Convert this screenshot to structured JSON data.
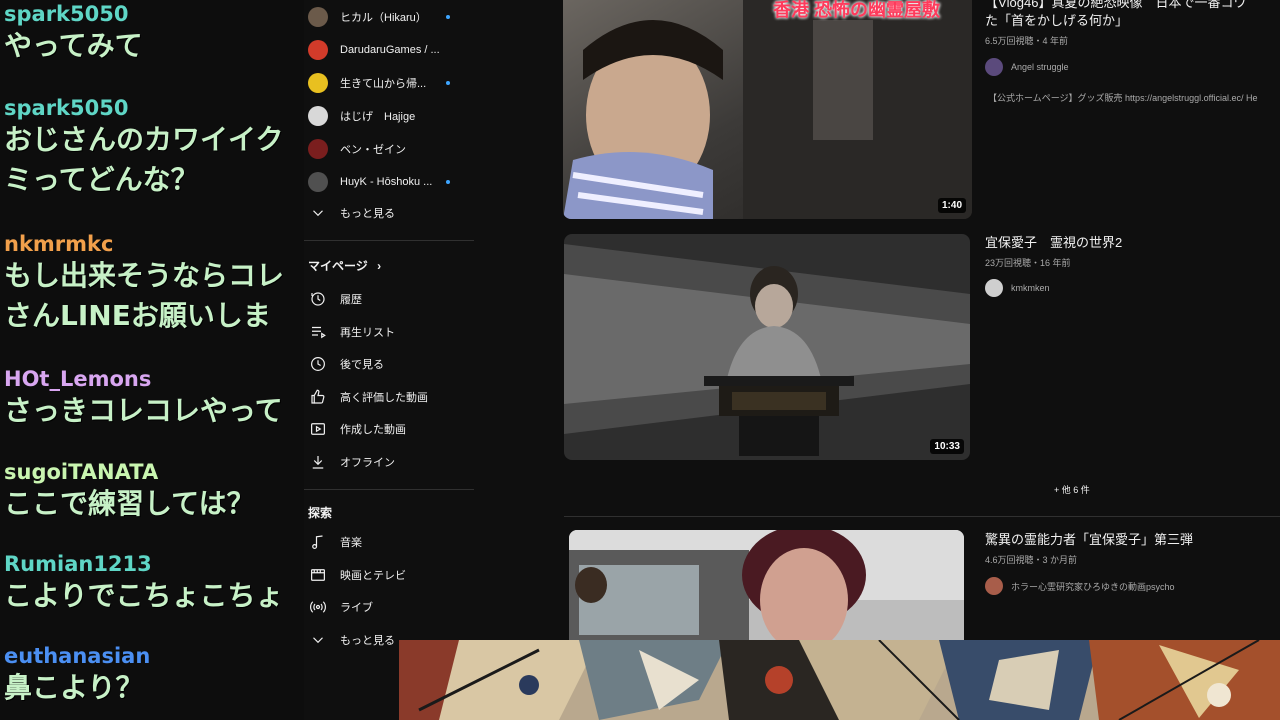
{
  "chat": {
    "messages": [
      {
        "user": "spark5050",
        "text": "やってみて",
        "user_color": "#5fd6c6"
      },
      {
        "user": "spark5050",
        "text": "おじさんのカワイイク\nミってどんな？",
        "user_color": "#5fd6c6"
      },
      {
        "user": "nkmrmkc",
        "text": "もし出来そうならコレ\nさんLINEお願いしま",
        "user_color": "#f2a04b"
      },
      {
        "user": "HOt_Lemons",
        "text": "さっきコレコレやって",
        "user_color": "#d8a6f0"
      },
      {
        "user": "sugoiTANATA",
        "text": "ここで練習しては？",
        "user_color": "#c9f5b0"
      },
      {
        "user": "Rumian1213",
        "text": "こよりでこちょこちょ",
        "user_color": "#5fd6c6"
      },
      {
        "user": "euthanasian",
        "text": "鼻こより？",
        "user_color": "#4b8ff2"
      }
    ]
  },
  "sidebar": {
    "subscriptions": [
      {
        "name": "ヒカル（Hikaru）",
        "live": true,
        "color": "#6b5a4a",
        "icon": "avatar-hikaru"
      },
      {
        "name": "DarudaruGames / ...",
        "live": false,
        "color": "#d23b2a",
        "icon": "avatar-darudaru"
      },
      {
        "name": "生きて山から帰...",
        "live": true,
        "color": "#e8c020",
        "icon": "avatar-ikite"
      },
      {
        "name": "はじげ　Hajige",
        "live": false,
        "color": "#d8d8d8",
        "icon": "avatar-hajige"
      },
      {
        "name": "ベン・ゼイン",
        "live": false,
        "color": "#7a1e1e",
        "icon": "avatar-ben"
      },
      {
        "name": "HuyK - Hōshoku ...",
        "live": true,
        "color": "#505050",
        "icon": "avatar-huyk"
      }
    ],
    "show_more_label": "もっと見る",
    "mypage_label": "マイページ",
    "mypage_items": [
      {
        "label": "履歴",
        "icon": "history-icon"
      },
      {
        "label": "再生リスト",
        "icon": "playlist-icon"
      },
      {
        "label": "後で見る",
        "icon": "watch-later-icon"
      },
      {
        "label": "高く評価した動画",
        "icon": "thumbs-up-icon"
      },
      {
        "label": "作成した動画",
        "icon": "your-videos-icon"
      },
      {
        "label": "オフライン",
        "icon": "download-icon"
      }
    ],
    "explore_label": "探索",
    "explore_items": [
      {
        "label": "音楽",
        "icon": "music-icon"
      },
      {
        "label": "映画とテレビ",
        "icon": "film-icon"
      },
      {
        "label": "ライブ",
        "icon": "live-icon"
      },
      {
        "label": "もっと見る",
        "icon": "chevron-down-icon"
      }
    ]
  },
  "videos": [
    {
      "title": "【Vlog46】真夏の絶恐映像　日本で一番コワ\nた「首をかしげる何か」",
      "meta": "6.5万回視聴・4 年前",
      "channel": "Angel struggle",
      "description": "【公式ホームページ】グッズ販売 https://angelstruggl.official.ec/ He",
      "duration": "1:40",
      "thumb_caption": "香港 恐怖の幽霊屋敷"
    },
    {
      "title": "宜保愛子　霊視の世界2",
      "meta": "23万回視聴・16 年前",
      "channel": "kmkmken",
      "duration": "10:33"
    },
    {
      "title": "驚異の霊能力者「宜保愛子」第三弾",
      "meta": "4.6万回視聴・3 か月前",
      "channel": "ホラー心霊研究家ひろゆきの動画psycho"
    }
  ],
  "more_results": "+ 他 6 件"
}
